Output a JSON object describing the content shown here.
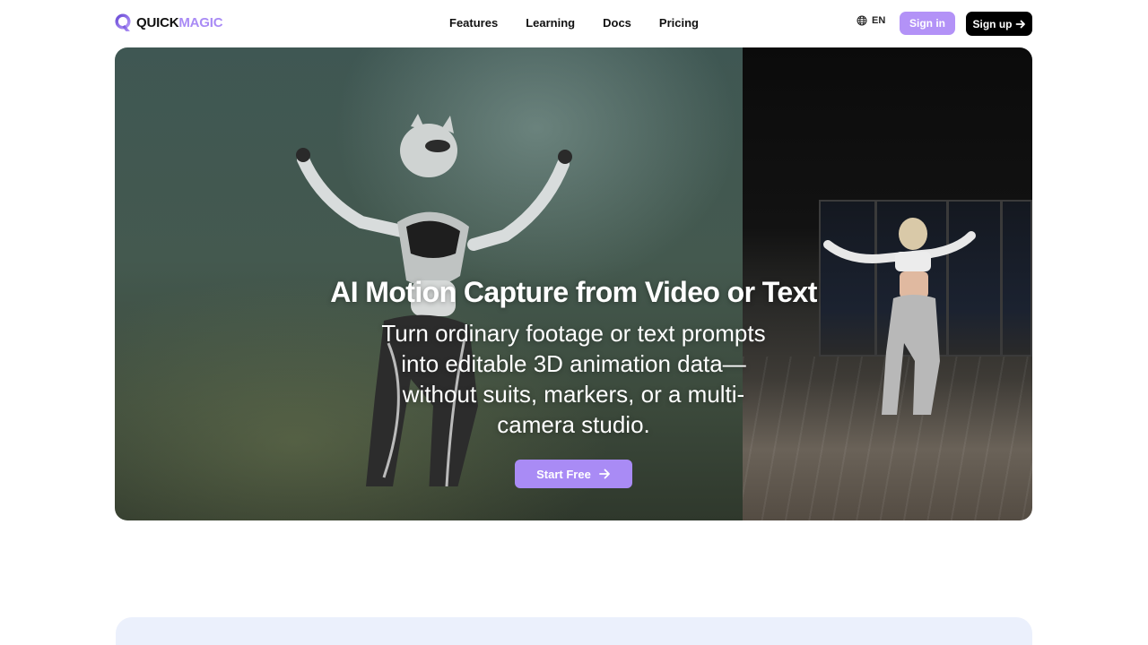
{
  "brand": {
    "part1": "QUICK",
    "part2": "MAGIC",
    "accent": "#a98bf5"
  },
  "nav": {
    "items": [
      "Features",
      "Learning",
      "Docs",
      "Pricing"
    ],
    "language": "EN",
    "sign_in": "Sign in",
    "sign_up": "Sign up"
  },
  "hero": {
    "title": "AI Motion Capture from Video or Text",
    "subtitle": "Turn ordinary footage or text prompts into editable 3D animation data—without suits, markers, or a multi-camera studio.",
    "cta": "Start Free"
  },
  "icons": {
    "globe": "globe-icon",
    "arrow": "arrow-right-icon"
  },
  "colors": {
    "sign_in_bg": "#b392f7",
    "sign_up_bg": "#000000",
    "cta_bg": "#a98bf5",
    "next_section_bg": "#ebf0fc"
  }
}
